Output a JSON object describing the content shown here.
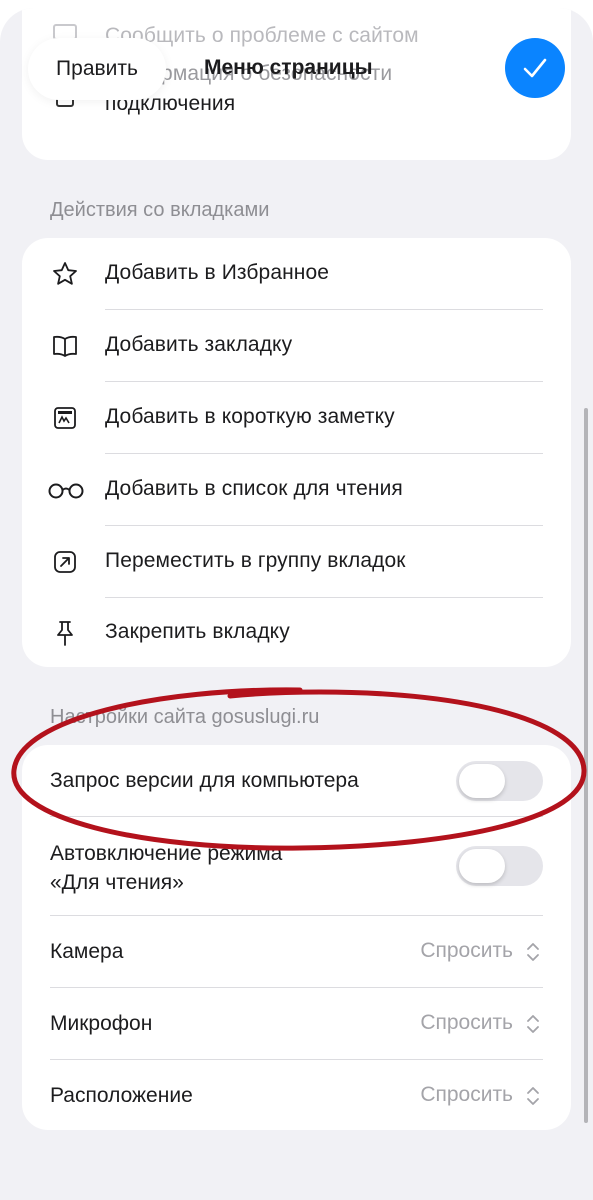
{
  "header": {
    "edit_label": "Править",
    "title": "Меню страницы"
  },
  "top_card": {
    "items": [
      {
        "label": "Сообщить о проблеме с сайтом",
        "icon": "speech-bubble-icon"
      },
      {
        "label_line1": "Информация о безопасности",
        "label_line2": "подключения",
        "icon": "lock-icon"
      }
    ]
  },
  "tab_actions": {
    "header": "Действия со вкладками",
    "items": [
      {
        "label": "Добавить в Избранное",
        "icon": "star-icon"
      },
      {
        "label": "Добавить закладку",
        "icon": "book-icon"
      },
      {
        "label": "Добавить в короткую заметку",
        "icon": "quick-note-icon"
      },
      {
        "label": "Добавить в список для чтения",
        "icon": "glasses-icon"
      },
      {
        "label": "Переместить в группу вкладок",
        "icon": "move-arrow-icon"
      },
      {
        "label": "Закрепить вкладку",
        "icon": "pin-icon"
      }
    ]
  },
  "site_settings": {
    "header": "Настройки сайта gosuslugi.ru",
    "desktop_request": {
      "label": "Запрос версии для компьютера",
      "enabled": false
    },
    "auto_reader": {
      "label_line1": "Автовключение режима",
      "label_line2": "«Для чтения»",
      "enabled": false
    },
    "permissions": [
      {
        "label": "Камера",
        "value": "Спросить"
      },
      {
        "label": "Микрофон",
        "value": "Спросить"
      },
      {
        "label": "Расположение",
        "value": "Спросить"
      }
    ]
  },
  "colors": {
    "accent": "#0a84ff",
    "annotation": "#b3121c",
    "background": "#f1f1f5",
    "secondary_text": "#8e8e93"
  }
}
